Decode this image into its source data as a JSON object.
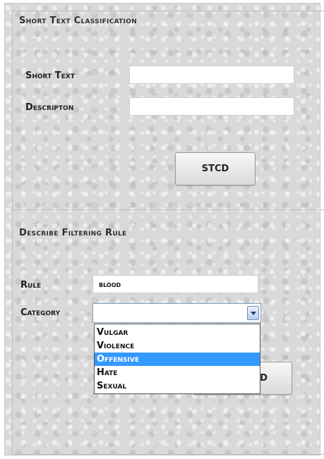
{
  "classification": {
    "title": "Short Text Classification",
    "short_text_label": "Short Text",
    "short_text_value": "",
    "description_label": "Descripton",
    "description_value": "",
    "submit_label": "STCD"
  },
  "filtering": {
    "title": "Describe Filtering Rule",
    "rule_label": "Rule",
    "rule_value": "blood",
    "category_label": "Category",
    "category_value": "",
    "category_options": [
      "Vulgar",
      "Violence",
      "Offensive",
      "Hate",
      "Sexual"
    ],
    "highlighted_option": "Offensive",
    "add_button_label": "D"
  },
  "colors": {
    "selection": "#3399ff",
    "dropdown_border": "#7f9db9"
  }
}
